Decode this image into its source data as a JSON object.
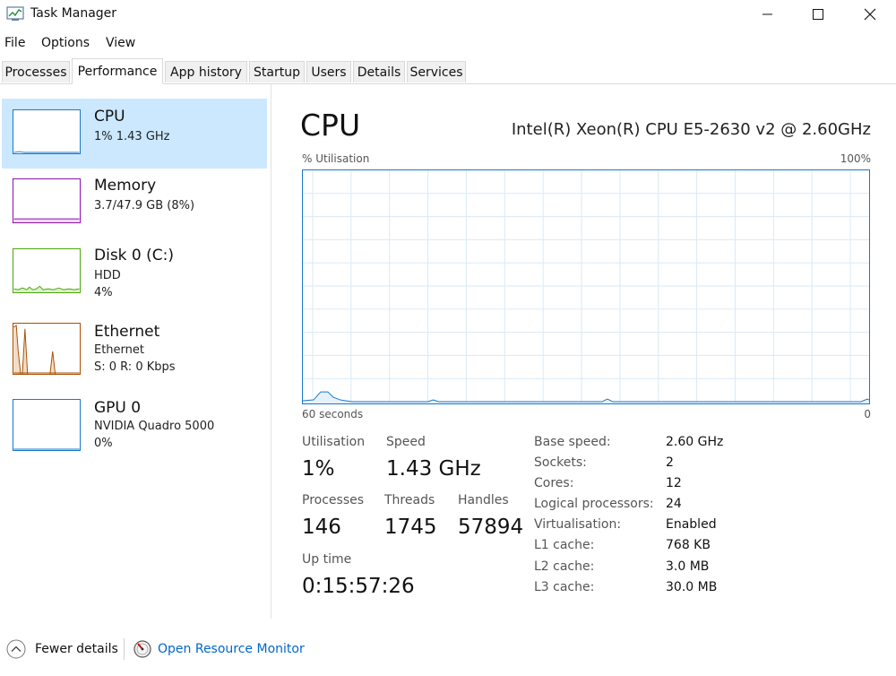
{
  "window": {
    "title": "Task Manager"
  },
  "menu": [
    "File",
    "Options",
    "View"
  ],
  "tabs": [
    "Processes",
    "Performance",
    "App history",
    "Startup",
    "Users",
    "Details",
    "Services"
  ],
  "active_tab": "Performance",
  "sidebar": [
    {
      "title": "CPU",
      "lines": [
        "1%  1.43 GHz"
      ],
      "color": "#1979ca"
    },
    {
      "title": "Memory",
      "lines": [
        "3.7/47.9 GB (8%)"
      ],
      "color": "#8b12ae"
    },
    {
      "title": "Disk 0 (C:)",
      "lines": [
        "HDD",
        "4%"
      ],
      "color": "#4da60c"
    },
    {
      "title": "Ethernet",
      "lines": [
        "Ethernet",
        "S: 0  R: 0 Kbps"
      ],
      "color": "#a74f01"
    },
    {
      "title": "GPU 0",
      "lines": [
        "NVIDIA Quadro 5000",
        "0%"
      ],
      "color": "#1979ca"
    }
  ],
  "main": {
    "title": "CPU",
    "model": "Intel(R) Xeon(R) CPU E5-2630 v2 @ 2.60GHz",
    "graph_top_left": "% Utilisation",
    "graph_top_right": "100%",
    "graph_bottom_left": "60 seconds",
    "graph_bottom_right": "0",
    "accent_color": "#1979ca",
    "grid_color": "#d9eaf7"
  },
  "stats": {
    "utilisation_label": "Utilisation",
    "utilisation": "1%",
    "speed_label": "Speed",
    "speed": "1.43 GHz",
    "processes_label": "Processes",
    "processes": "146",
    "threads_label": "Threads",
    "threads": "1745",
    "handles_label": "Handles",
    "handles": "57894",
    "uptime_label": "Up time",
    "uptime": "0:15:57:26"
  },
  "specs": [
    {
      "key": "Base speed:",
      "value": "2.60 GHz"
    },
    {
      "key": "Sockets:",
      "value": "2"
    },
    {
      "key": "Cores:",
      "value": "12"
    },
    {
      "key": "Logical processors:",
      "value": "24"
    },
    {
      "key": "Virtualisation:",
      "value": "Enabled"
    },
    {
      "key": "L1 cache:",
      "value": "768 KB"
    },
    {
      "key": "L2 cache:",
      "value": "3.0 MB"
    },
    {
      "key": "L3 cache:",
      "value": "30.0 MB"
    }
  ],
  "footer": {
    "fewer_details": "Fewer details",
    "resource_monitor": "Open Resource Monitor",
    "link_color": "#0066cc"
  },
  "icons": {
    "app": "task-manager-icon",
    "minimize": "minimize-icon",
    "maximize": "maximize-icon",
    "close": "close-icon",
    "fewer": "chevron-up-circle-icon",
    "monitor": "resource-monitor-icon"
  }
}
